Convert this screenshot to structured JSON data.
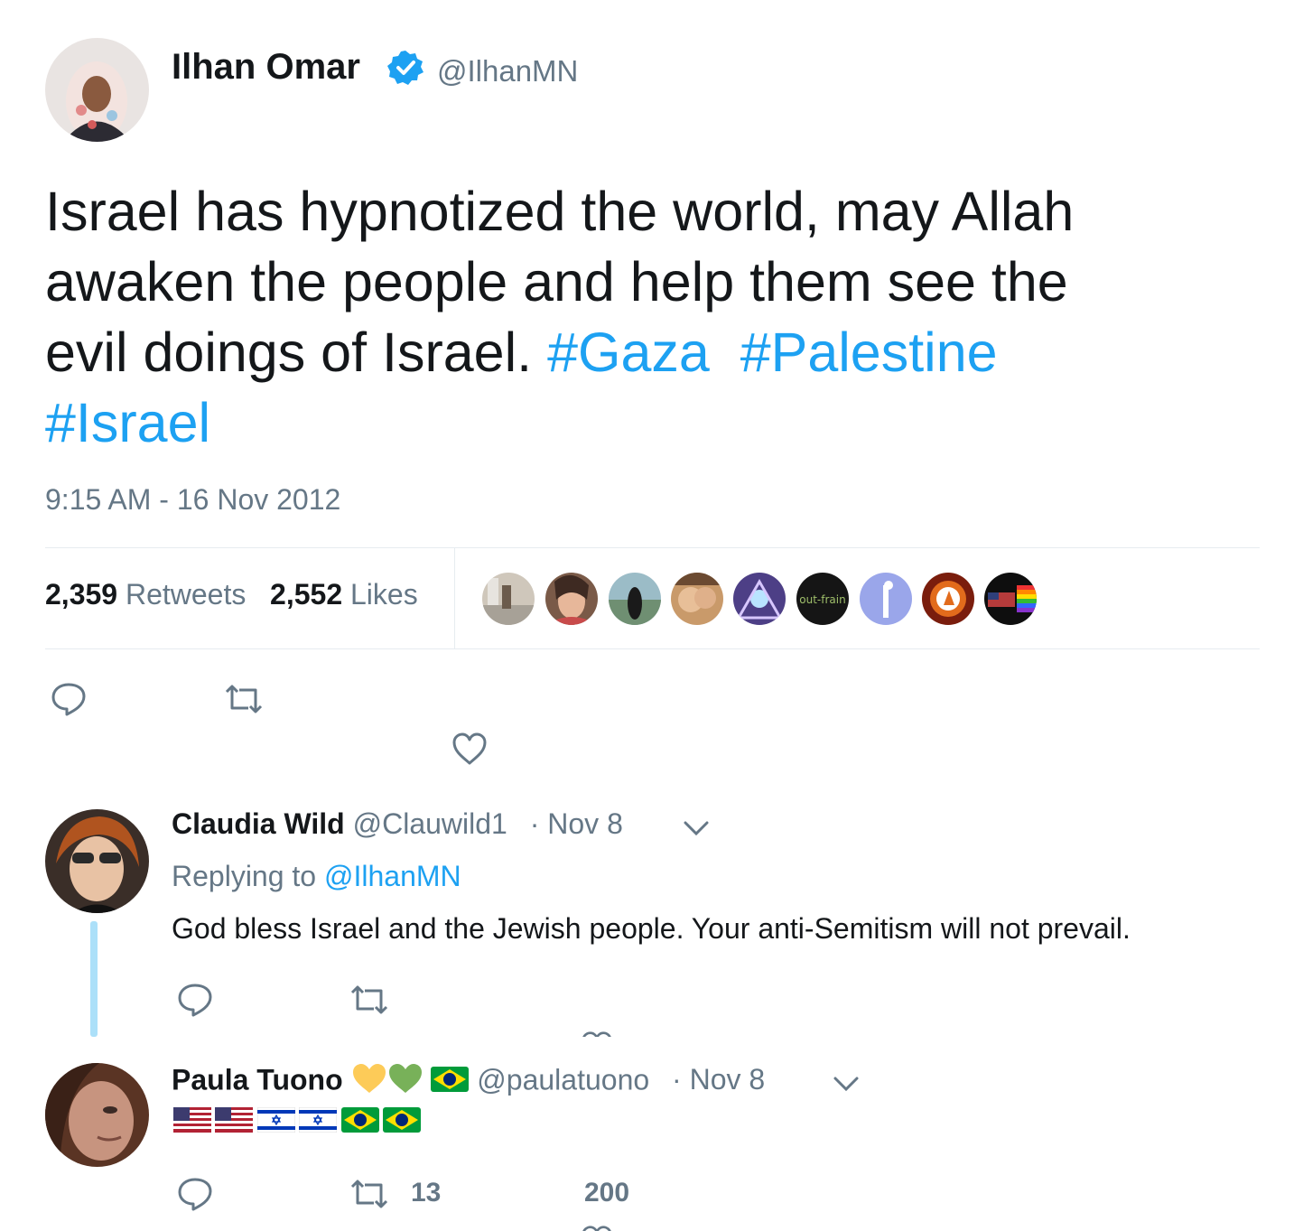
{
  "main_tweet": {
    "author_name": "Ilhan Omar",
    "author_handle": "@IlhanMN",
    "text_lines": [
      "Israel has hypnotized the world, may Allah",
      "awaken the people and help them see the",
      "evil doings of Israel."
    ],
    "hashtags": [
      "#Gaza",
      "#Palestine",
      "#Israel"
    ],
    "timestamp": "9:15 AM - 16 Nov 2012",
    "retweet_count": "2,359",
    "retweet_label": "Retweets",
    "like_count": "2,552",
    "like_label": "Likes",
    "liker_avatar_text": "out-frain"
  },
  "replies": [
    {
      "author_name": "Claudia Wild",
      "author_handle": "@Clauwild1",
      "date": "· Nov 8",
      "replying_to_label": "Replying to",
      "replying_to_handle": "@IlhanMN",
      "text": "God bless Israel and the Jewish people. Your anti-Semitism will not prevail."
    },
    {
      "author_name": "Paula Tuono",
      "author_handle": "@paulatuono",
      "date": "· Nov 8",
      "retweet_count": "13",
      "like_count": "200"
    }
  ],
  "colors": {
    "accent": "#1da1f2",
    "muted": "#657786",
    "text": "#14171a",
    "thread_line": "#ace0f9"
  },
  "icons": [
    "verified-icon",
    "reply-icon",
    "retweet-icon",
    "like-icon",
    "chevron-down-icon"
  ]
}
